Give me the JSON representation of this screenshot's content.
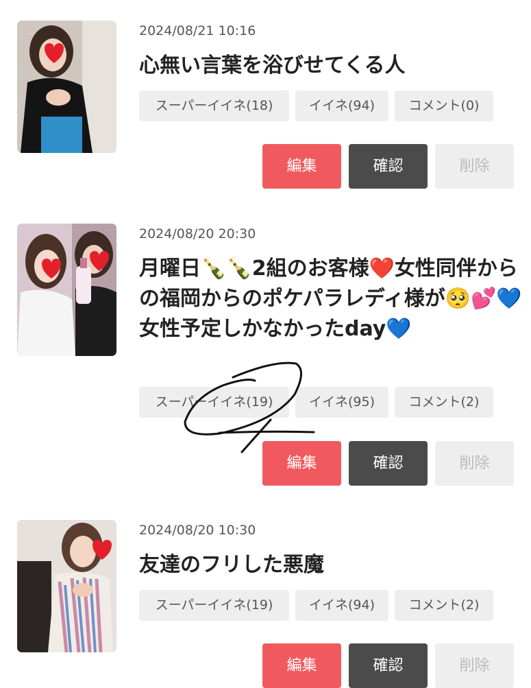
{
  "posts": [
    {
      "date": "2024/08/21 10:16",
      "title": "心無い言葉を浴びせてくる人",
      "super_like": "スーパーイイネ(18)",
      "like": "イイネ(94)",
      "comment": "コメント(0)"
    },
    {
      "date": "2024/08/20 20:30",
      "title": "月曜日🍾🍾2組のお客様❤️女性同伴からの福岡からのポケパラレディ様が🥺💕💙女性予定しかなかったday💙",
      "super_like": "スーパーイイネ(19)",
      "like": "イイネ(95)",
      "comment": "コメント(2)"
    },
    {
      "date": "2024/08/20 10:30",
      "title": "友達のフリした悪魔",
      "super_like": "スーパーイイネ(19)",
      "like": "イイネ(94)",
      "comment": "コメント(2)"
    }
  ],
  "buttons": {
    "edit": "編集",
    "confirm": "確認",
    "delete": "削除"
  },
  "colors": {
    "edit_button": "#f05a5e",
    "confirm_button": "#4b4b4b",
    "chip_background": "#eeeeee"
  }
}
